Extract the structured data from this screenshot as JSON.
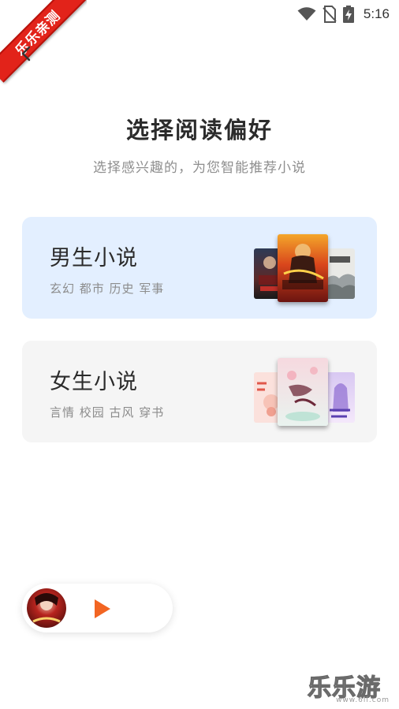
{
  "status_bar": {
    "time": "5:16",
    "icons": [
      "wifi-icon",
      "no-sim-icon",
      "battery-charging-icon"
    ]
  },
  "watermark": {
    "ribbon_text": "乐乐亲测",
    "bottom_text": "乐乐游戏",
    "bottom_url": "www.6ll.com"
  },
  "header": {
    "back_icon": "chevron-left-icon",
    "title": "选择阅读偏好",
    "subtitle": "选择感兴趣的，为您智能推荐小说"
  },
  "cards": [
    {
      "id": "male",
      "title": "男生小说",
      "tags": "玄幻 都市 历史 军事",
      "background": "#e3efff"
    },
    {
      "id": "female",
      "title": "女生小说",
      "tags": "言情 校园 古风 穿书",
      "background": "#f5f5f5"
    }
  ],
  "mini_player": {
    "play_icon": "play-icon",
    "accent": "#f26522"
  }
}
